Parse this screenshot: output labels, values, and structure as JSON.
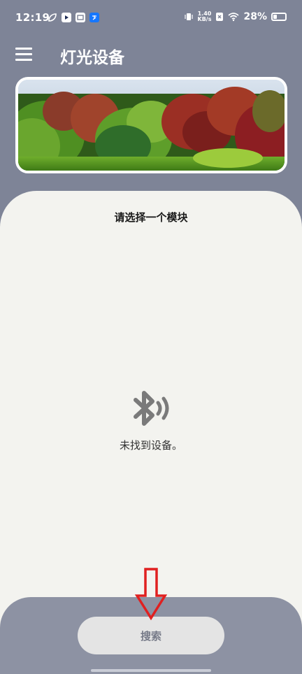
{
  "status_bar": {
    "time": "12:19",
    "network_speed_value": "1.40",
    "network_speed_unit": "KB/s",
    "battery_percent": "28%",
    "battery_level": 0.28
  },
  "header": {
    "title": "灯光设备"
  },
  "banner": {
    "icon": "aquarium-plants-image"
  },
  "module_panel": {
    "title": "请选择一个模块",
    "empty_icon": "bluetooth-searching-icon",
    "empty_text": "未找到设备。"
  },
  "bottom": {
    "search_label": "搜索"
  },
  "colors": {
    "background": "#7e8497",
    "card": "#f3f3ef",
    "bottom_panel": "#8d92a3",
    "button": "#e4e4e4",
    "button_text": "#767a88",
    "annotation_arrow": "#e02020"
  }
}
